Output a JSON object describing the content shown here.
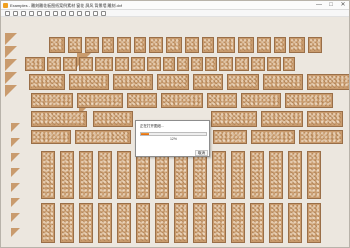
{
  "window": {
    "title": "Examples - 雕刻雕花板图纸案例素材 窗花 屏风 背景墙 雕刻.dxf",
    "minimize_label": "—",
    "maximize_label": "□",
    "close_label": "✕"
  },
  "toolbar": {
    "icons": [
      "open-icon",
      "save-icon",
      "print-icon",
      "undo-icon",
      "redo-icon",
      "zoom-in-icon",
      "zoom-out-icon",
      "fit-icon",
      "pan-icon",
      "measure-icon",
      "layers-icon",
      "settings-icon",
      "help-icon"
    ],
    "zoom_level": ""
  },
  "dialog": {
    "title": "正在打开图纸...",
    "progress_value": 0.12,
    "progress_text": "12%",
    "cancel_label": "取消"
  },
  "colors": {
    "panel": "#c99b6d",
    "panel_edge": "#9a6f48",
    "background": "#ece7df",
    "progress": "#e0640a"
  }
}
